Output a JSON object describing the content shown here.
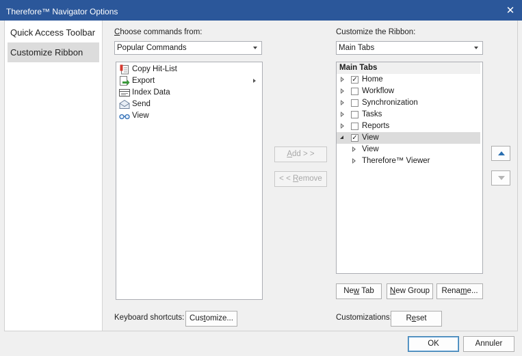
{
  "window": {
    "title": "Therefore™ Navigator Options",
    "close_glyph": "✕"
  },
  "nav": {
    "items": [
      {
        "label": "Quick Access Toolbar",
        "selected": false
      },
      {
        "label": "Customize Ribbon",
        "selected": true
      }
    ]
  },
  "commands": {
    "label_access": "C",
    "label_rest": "hoose commands from:",
    "source_value": "Popular Commands",
    "items": [
      {
        "label": "Copy Hit-List",
        "icon": "copy-hitlist-icon",
        "has_submenu": false
      },
      {
        "label": "Export",
        "icon": "export-icon",
        "has_submenu": true
      },
      {
        "label": "Index Data",
        "icon": "index-data-icon",
        "has_submenu": false
      },
      {
        "label": "Send",
        "icon": "envelope-icon",
        "has_submenu": false
      },
      {
        "label": "View",
        "icon": "glasses-icon",
        "has_submenu": false
      }
    ]
  },
  "middle": {
    "add_access": "A",
    "add_rest": "dd > >",
    "remove_before": "< < ",
    "remove_access": "R",
    "remove_rest": "emove"
  },
  "ribbon": {
    "label": "Customize the Ribbon:",
    "tabs_value": "Main Tabs",
    "tree_header": "Main Tabs",
    "tree": [
      {
        "label": "Home",
        "checked": true,
        "expanded": false,
        "level": 0,
        "selected": false
      },
      {
        "label": "Workflow",
        "checked": false,
        "expanded": false,
        "level": 0,
        "selected": false
      },
      {
        "label": "Synchronization",
        "checked": false,
        "expanded": false,
        "level": 0,
        "selected": false
      },
      {
        "label": "Tasks",
        "checked": false,
        "expanded": false,
        "level": 0,
        "selected": false
      },
      {
        "label": "Reports",
        "checked": false,
        "expanded": false,
        "level": 0,
        "selected": false
      },
      {
        "label": "View",
        "checked": true,
        "expanded": true,
        "level": 0,
        "selected": true
      },
      {
        "label": "View",
        "checked": null,
        "expanded": false,
        "level": 1,
        "selected": false
      },
      {
        "label": "Therefore™ Viewer",
        "checked": null,
        "expanded": false,
        "level": 1,
        "selected": false
      }
    ],
    "new_tab_before": "Ne",
    "new_tab_access": "w",
    "new_tab_rest": " Tab",
    "new_group_before": "",
    "new_group_access": "N",
    "new_group_rest": "ew Group",
    "rename_before": "Rena",
    "rename_access": "m",
    "rename_rest": "e...",
    "move_up_icon": "triangle-up-icon",
    "move_down_icon": "triangle-down-icon"
  },
  "footer": {
    "keyboard_label": "Keyboard shortcuts:",
    "customize_before": "Cus",
    "customize_access": "t",
    "customize_rest": "omize...",
    "customizations_label": "Customizations:",
    "reset_before": "R",
    "reset_access": "e",
    "reset_rest": "set",
    "ok_label": "OK",
    "cancel_label": "Annuler"
  },
  "colors": {
    "titlebar": "#2b579a",
    "selection": "#dcdcdc",
    "accent_arrow": "#2a6fb0"
  }
}
